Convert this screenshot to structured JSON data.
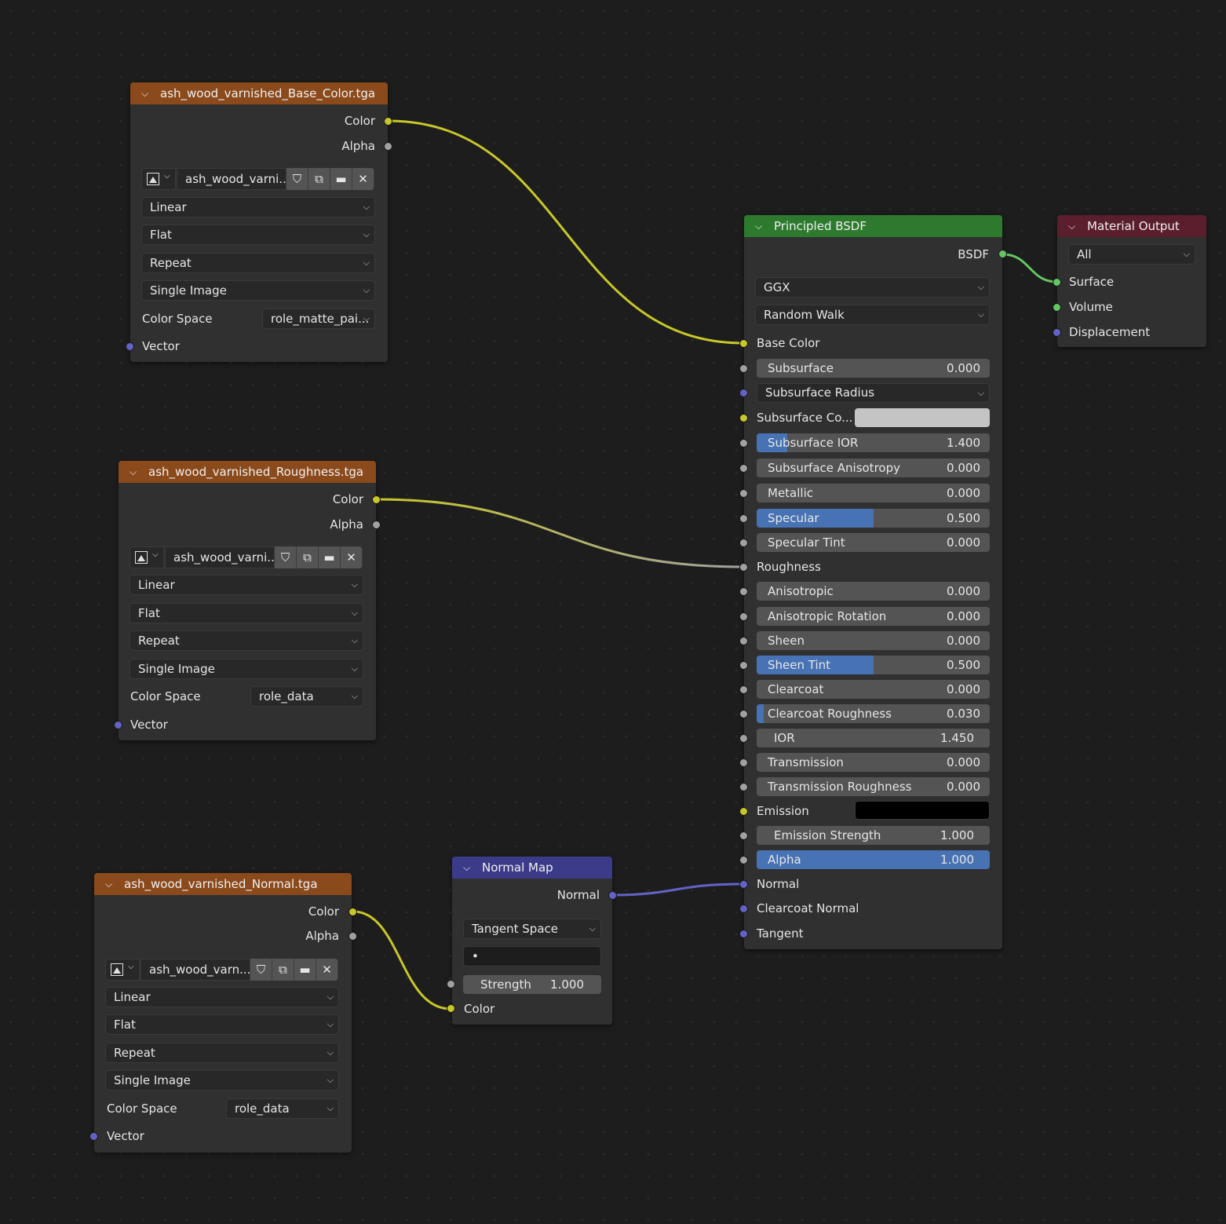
{
  "tex1": {
    "title": "ash_wood_varnished_Base_Color.tga",
    "out_color": "Color",
    "out_alpha": "Alpha",
    "image_name": "ash_wood_varni...",
    "interpolation": "Linear",
    "projection": "Flat",
    "extension": "Repeat",
    "source": "Single Image",
    "color_space_label": "Color Space",
    "color_space": "role_matte_pai...",
    "in_vector": "Vector"
  },
  "tex2": {
    "title": "ash_wood_varnished_Roughness.tga",
    "out_color": "Color",
    "out_alpha": "Alpha",
    "image_name": "ash_wood_varni...",
    "interpolation": "Linear",
    "projection": "Flat",
    "extension": "Repeat",
    "source": "Single Image",
    "color_space_label": "Color Space",
    "color_space": "role_data",
    "in_vector": "Vector"
  },
  "tex3": {
    "title": "ash_wood_varnished_Normal.tga",
    "out_color": "Color",
    "out_alpha": "Alpha",
    "image_name": "ash_wood_varn...",
    "interpolation": "Linear",
    "projection": "Flat",
    "extension": "Repeat",
    "source": "Single Image",
    "color_space_label": "Color Space",
    "color_space": "role_data",
    "in_vector": "Vector"
  },
  "normal_map": {
    "title": "Normal Map",
    "out_normal": "Normal",
    "space": "Tangent Space",
    "uv": "•",
    "strength_label": "Strength",
    "strength_value": "1.000",
    "in_color": "Color"
  },
  "bsdf": {
    "title": "Principled BSDF",
    "out_bsdf": "BSDF",
    "distribution": "GGX",
    "subsurface_method": "Random Walk",
    "base_color": "Base Color",
    "subsurface": {
      "label": "Subsurface",
      "value": "0.000"
    },
    "subsurface_radius": "Subsurface Radius",
    "subsurface_color": "Subsurface Co...",
    "subsurface_ior": {
      "label": "Subsurface IOR",
      "value": "1.400",
      "fill": 0.13
    },
    "subsurface_anisotropy": {
      "label": "Subsurface Anisotropy",
      "value": "0.000"
    },
    "metallic": {
      "label": "Metallic",
      "value": "0.000"
    },
    "specular": {
      "label": "Specular",
      "value": "0.500",
      "fill": 0.5
    },
    "specular_tint": {
      "label": "Specular Tint",
      "value": "0.000"
    },
    "roughness": "Roughness",
    "anisotropic": {
      "label": "Anisotropic",
      "value": "0.000"
    },
    "anisotropic_rotation": {
      "label": "Anisotropic Rotation",
      "value": "0.000"
    },
    "sheen": {
      "label": "Sheen",
      "value": "0.000"
    },
    "sheen_tint": {
      "label": "Sheen Tint",
      "value": "0.500",
      "fill": 0.5
    },
    "clearcoat": {
      "label": "Clearcoat",
      "value": "0.000"
    },
    "clearcoat_roughness": {
      "label": "Clearcoat Roughness",
      "value": "0.030",
      "fill": 0.03
    },
    "ior": {
      "label": "IOR",
      "value": "1.450"
    },
    "transmission": {
      "label": "Transmission",
      "value": "0.000"
    },
    "transmission_roughness": {
      "label": "Transmission Roughness",
      "value": "0.000"
    },
    "emission": "Emission",
    "emission_strength": {
      "label": "Emission Strength",
      "value": "1.000"
    },
    "alpha": {
      "label": "Alpha",
      "value": "1.000",
      "fill": 1.0
    },
    "normal": "Normal",
    "clearcoat_normal": "Clearcoat Normal",
    "tangent": "Tangent",
    "subsurface_color_swatch": "#c4c4c4",
    "emission_color_swatch": "#000000"
  },
  "output": {
    "title": "Material Output",
    "target": "All",
    "surface": "Surface",
    "volume": "Volume",
    "displacement": "Displacement"
  },
  "icons": [
    "chevron-down-icon",
    "image-icon",
    "shield-icon",
    "duplicate-icon",
    "folder-icon",
    "close-icon"
  ],
  "colors": {
    "texture_header": "#8b4a1c",
    "shader_header": "#2d7a2e",
    "vector_header": "#3b3b8a",
    "output_header": "#5a1e2c",
    "socket_color": "#c7c729",
    "socket_float": "#a1a1a1",
    "socket_vector": "#6363c7",
    "socket_shader": "#63c763",
    "slider_fill": "#4772b3"
  }
}
